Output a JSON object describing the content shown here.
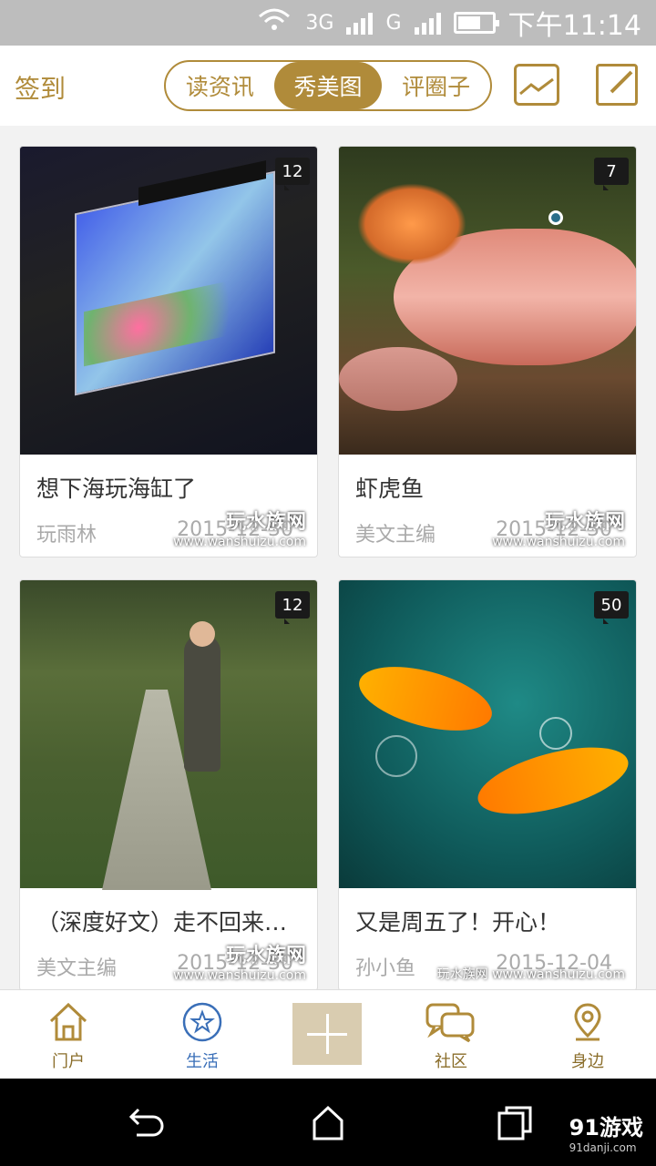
{
  "status": {
    "network": "3G",
    "carrier_g": "G",
    "time": "下午11:14"
  },
  "header": {
    "checkin": "签到",
    "tabs": [
      "读资讯",
      "秀美图",
      "评圈子"
    ],
    "active_tab": 1,
    "photo_icon": "photo-upload-icon",
    "edit_icon": "compose-icon"
  },
  "feed": {
    "watermark_brand": "玩水族网",
    "watermark_url": "www.wanshuizu.com",
    "cards": [
      {
        "count": "12",
        "title": "想下海玩海缸了",
        "author": "玩雨林",
        "date": "2015-12-30"
      },
      {
        "count": "7",
        "title": "虾虎鱼",
        "author": "美文主编",
        "date": "2015-12-30"
      },
      {
        "count": "12",
        "title": "（深度好文）走不回来…",
        "author": "美文主编",
        "date": "2015-12-30"
      },
      {
        "count": "50",
        "title": "又是周五了！开心！",
        "author": "孙小鱼",
        "date": "2015-12-04"
      }
    ]
  },
  "tabbar": {
    "items": [
      {
        "label": "门户",
        "icon": "home-icon"
      },
      {
        "label": "生活",
        "icon": "star-circle-icon"
      },
      {
        "label": "",
        "icon": "plus-icon"
      },
      {
        "label": "社区",
        "icon": "chat-bubbles-icon"
      },
      {
        "label": "身边",
        "icon": "location-pin-icon"
      }
    ],
    "active": 1
  },
  "watermark": {
    "brand": "91游戏",
    "site": "91danji.com"
  },
  "colors": {
    "accent": "#b08b3a",
    "active_tab": "#3a6fb8"
  }
}
